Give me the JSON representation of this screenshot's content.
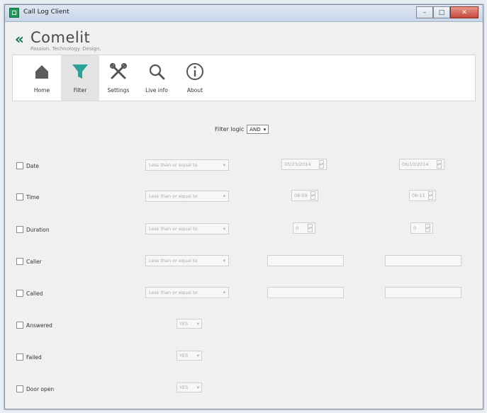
{
  "window": {
    "title": "Call Log Client"
  },
  "logo": {
    "mark": "«",
    "name": "Comelit",
    "tagline": "Passion. Technology. Design."
  },
  "toolbar": {
    "items": [
      {
        "label": "Home",
        "icon": "home-icon"
      },
      {
        "label": "Filter",
        "icon": "filter-icon",
        "active": true
      },
      {
        "label": "Settings",
        "icon": "settings-icon"
      },
      {
        "label": "Live info",
        "icon": "search-icon"
      },
      {
        "label": "About",
        "icon": "info-icon"
      }
    ]
  },
  "filter_logic": {
    "label": "Filter logic",
    "value": "AND"
  },
  "rows": {
    "date": {
      "label": "Date",
      "operator": "Less than or equal to",
      "from": "05/23/2014",
      "to": "06/10/2014"
    },
    "time": {
      "label": "Time",
      "operator": "Less than or equal to",
      "from": "08:09",
      "to": "08:11"
    },
    "duration": {
      "label": "Duration",
      "operator": "Less than or equal to",
      "from": "0",
      "to": "0"
    },
    "caller": {
      "label": "Caller",
      "operator": "Less than or equal to"
    },
    "called": {
      "label": "Called",
      "operator": "Less than or equal to"
    },
    "answered": {
      "label": "Answered",
      "value": "YES"
    },
    "failed": {
      "label": "Failed",
      "value": "YES"
    },
    "door_open": {
      "label": "Door open",
      "value": "YES"
    }
  },
  "colors": {
    "brand_green": "#0d7a44",
    "filter_teal": "#2aa198"
  }
}
